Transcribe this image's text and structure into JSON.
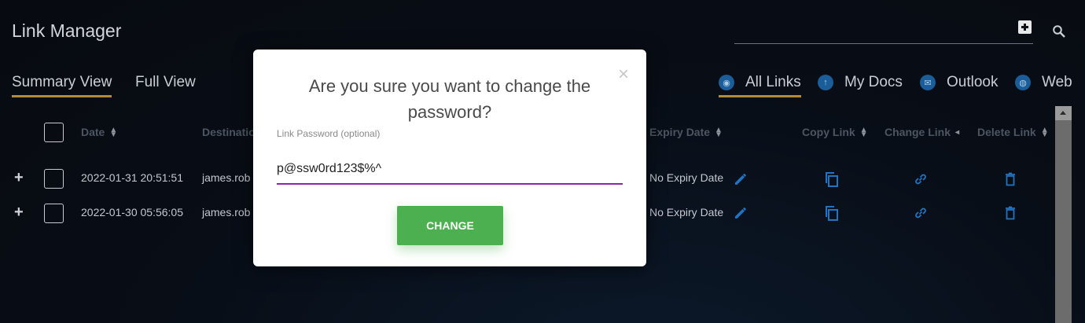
{
  "header": {
    "title": "Link Manager",
    "search_value": ""
  },
  "views": [
    {
      "label": "Summary View",
      "active": true
    },
    {
      "label": "Full View",
      "active": false
    }
  ],
  "filters": [
    {
      "label": "All Links",
      "icon": "eye-icon",
      "active": true
    },
    {
      "label": "My Docs",
      "icon": "upload-icon",
      "active": false
    },
    {
      "label": "Outlook",
      "icon": "outlook-icon",
      "active": false
    },
    {
      "label": "Web",
      "icon": "globe-icon",
      "active": false
    }
  ],
  "table": {
    "columns": {
      "date": "Date",
      "destination": "Destinatio",
      "expiry": "Expiry Date",
      "copy": "Copy Link",
      "change": "Change Link",
      "delete": "Delete Link"
    },
    "rows": [
      {
        "date": "2022-01-31 20:51:51",
        "destination": "james.rob",
        "expiry": "No Expiry Date"
      },
      {
        "date": "2022-01-30 05:56:05",
        "destination": "james.rob",
        "expiry": "No Expiry Date"
      }
    ]
  },
  "modal": {
    "title": "Are you sure you want to change the password?",
    "field_label": "Link Password (optional)",
    "field_value": "p@ssw0rd123$%^",
    "button_label": "CHANGE",
    "close_glyph": "×"
  },
  "colors": {
    "accent_underline": "#b38a3a",
    "action_blue": "#1f74c4",
    "button_green": "#4caf50",
    "input_underline": "#8e24aa"
  }
}
